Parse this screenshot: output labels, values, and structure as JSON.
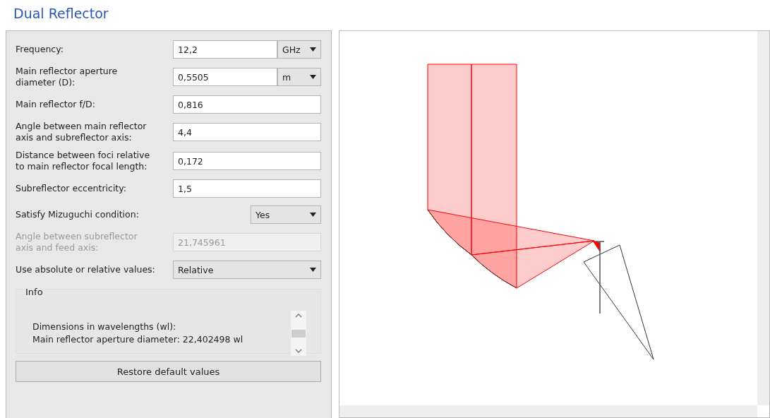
{
  "title": "Dual Reflector",
  "fields": [
    {
      "label": "Frequency:",
      "kind": "unit_input",
      "value": "12,2",
      "unit": "GHz",
      "disabled": false
    },
    {
      "label": "Main reflector aperture diameter (D):",
      "kind": "unit_input",
      "value": "0,5505",
      "unit": "m",
      "disabled": false
    },
    {
      "label": "Main reflector f/D:",
      "kind": "input",
      "value": "0,816",
      "disabled": false
    },
    {
      "label": "Angle between main reflector axis and subreflector axis:",
      "kind": "input",
      "value": "4,4",
      "disabled": false
    },
    {
      "label": "Distance between foci relative to main reflector focal length:",
      "kind": "input",
      "value": "0,172",
      "disabled": false
    },
    {
      "label": "Subreflector eccentricity:",
      "kind": "input",
      "value": "1,5",
      "disabled": false
    },
    {
      "label": "Satisfy Mizuguchi condition:",
      "kind": "short_select",
      "value": "Yes",
      "disabled": false
    },
    {
      "label": "Angle between subreflector axis and feed axis:",
      "kind": "input",
      "value": "21,745961",
      "disabled": true
    },
    {
      "label": "Use absolute or relative values:",
      "kind": "select",
      "value": "Relative",
      "disabled": false
    }
  ],
  "info": {
    "title": "Info",
    "lines": [
      "Dimensions in wavelengths (wl):",
      "Main reflector aperture diameter: 22,402498 wl"
    ]
  },
  "restore_button": "Restore default values"
}
